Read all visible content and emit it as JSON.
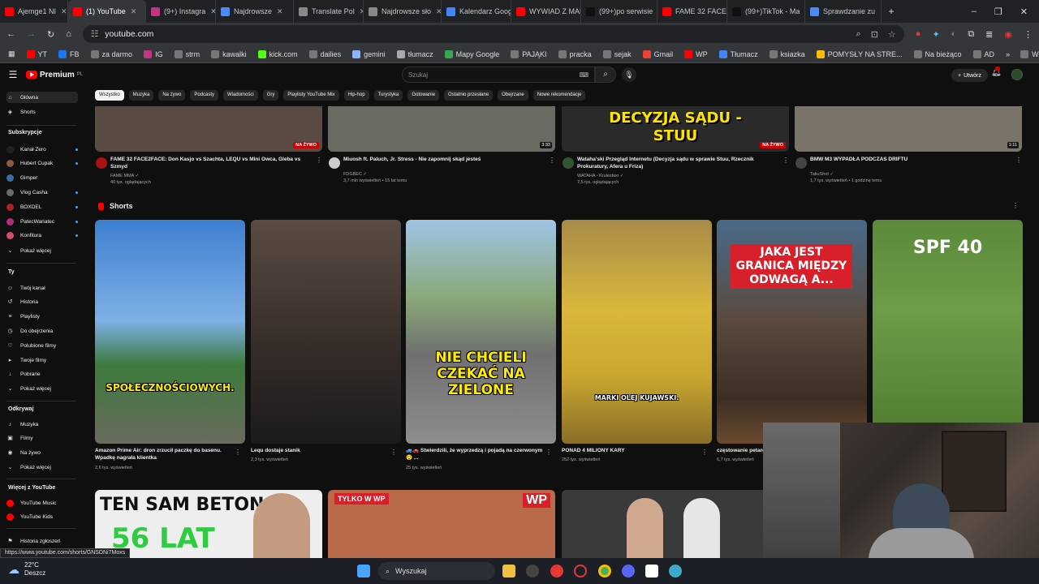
{
  "browser": {
    "tabs": [
      {
        "label": "Ajemge1 NI",
        "color": "#ff0000"
      },
      {
        "label": "(1) YouTube",
        "color": "#ff0000"
      },
      {
        "label": "(9+) Instagra",
        "color": "#c13584"
      },
      {
        "label": "Najdrowsze",
        "color": "#4c8bf5"
      },
      {
        "label": "Translate Pol",
        "color": "#888888"
      },
      {
        "label": "Najdrowsze sło",
        "color": "#888888"
      },
      {
        "label": "Kalendarz Googl",
        "color": "#4285f4"
      },
      {
        "label": "WYWIAD Z MAK",
        "color": "#ff0000"
      },
      {
        "label": "(99+)po serwisie",
        "color": "#111111"
      },
      {
        "label": "FAME 32 FACE2F",
        "color": "#ff0000"
      },
      {
        "label": "(99+)TikTok - Ma",
        "color": "#111111"
      },
      {
        "label": "Sprawdzanie zu",
        "color": "#4c8bf5"
      }
    ],
    "url": "youtube.com",
    "bookmarks": [
      {
        "label": "YT",
        "color": "#ff0000"
      },
      {
        "label": "FB",
        "color": "#1877f2"
      },
      {
        "label": "za darmo",
        "color": "#777777"
      },
      {
        "label": "IG",
        "color": "#c13584"
      },
      {
        "label": "strm",
        "color": "#777777"
      },
      {
        "label": "kawalki",
        "color": "#777777"
      },
      {
        "label": "kick.com",
        "color": "#53fc18"
      },
      {
        "label": "dailies",
        "color": "#777777"
      },
      {
        "label": "gemini",
        "color": "#8ab4f8"
      },
      {
        "label": "tłumacz",
        "color": "#aaaaaa"
      },
      {
        "label": "Mapy Google",
        "color": "#34a853"
      },
      {
        "label": "PAJĄKI",
        "color": "#777777"
      },
      {
        "label": "pracka",
        "color": "#777777"
      },
      {
        "label": "sejak",
        "color": "#777777"
      },
      {
        "label": "Gmail",
        "color": "#ea4335"
      },
      {
        "label": "WP",
        "color": "#ff0000"
      },
      {
        "label": "Tłumacz",
        "color": "#4285f4"
      },
      {
        "label": "ksiazka",
        "color": "#777777"
      },
      {
        "label": "POMYSŁY NA STRE...",
        "color": "#fbbc05"
      },
      {
        "label": "Na bieżąco",
        "color": "#777777"
      },
      {
        "label": "AD",
        "color": "#777777"
      }
    ],
    "all_bookmarks": "Wszystkie zakładki",
    "status_url": "https://www.youtube.com/shorts/GNSDNi7Moxs"
  },
  "youtube": {
    "logo": "Premium",
    "logo_sup": "PL",
    "search_placeholder": "Szukaj",
    "create_label": "Utwórz",
    "chips": [
      "Wszystko",
      "Muzyka",
      "Na żywo",
      "Podcasty",
      "Wiadomości",
      "Gry",
      "Playlisty YouTube Mix",
      "Hip-hop",
      "Turystyka",
      "Gotowanie",
      "Ostatnio przesłane",
      "Obejrzane",
      "Nowe rekomendacje"
    ]
  },
  "sidebar": {
    "main": [
      {
        "label": "Główna",
        "icon": "home-icon",
        "glyph": "⌂"
      },
      {
        "label": "Shorts",
        "icon": "shorts-icon",
        "glyph": "◈"
      }
    ],
    "subs_header": "Subskrypcje",
    "subs": [
      {
        "label": "Kanał Zero",
        "color": "#222222",
        "dot": true
      },
      {
        "label": "Hubert Cupak",
        "color": "#8a5a44",
        "dot": true
      },
      {
        "label": "Gimper",
        "color": "#3a6ea5",
        "dot": false
      },
      {
        "label": "Vlog Casha",
        "color": "#6b6b6b",
        "dot": true
      },
      {
        "label": "BOXDEL",
        "color": "#aa2222",
        "dot": true
      },
      {
        "label": "PatecWariatec",
        "color": "#b03080",
        "dot": true
      },
      {
        "label": "Konfitura",
        "color": "#d0506a",
        "dot": true
      }
    ],
    "subs_more": "Pokaż więcej",
    "you_header": "Ty",
    "you": [
      {
        "label": "Twój kanał",
        "icon": "user-icon",
        "glyph": "☺"
      },
      {
        "label": "Historia",
        "icon": "history-icon",
        "glyph": "↺"
      },
      {
        "label": "Playlisty",
        "icon": "playlist-icon",
        "glyph": "≡"
      },
      {
        "label": "Do obejrzenia",
        "icon": "clock-icon",
        "glyph": "◷"
      },
      {
        "label": "Polubione filmy",
        "icon": "like-icon",
        "glyph": "♡"
      },
      {
        "label": "Twoje filmy",
        "icon": "video-icon",
        "glyph": "▸"
      },
      {
        "label": "Pobrane",
        "icon": "download-icon",
        "glyph": "↓"
      },
      {
        "label": "Pokaż więcej",
        "icon": "chevron-down-icon",
        "glyph": "⌄"
      }
    ],
    "explore_header": "Odkrywaj",
    "explore": [
      {
        "label": "Muzyka",
        "icon": "music-icon",
        "glyph": "♪"
      },
      {
        "label": "Filmy",
        "icon": "film-icon",
        "glyph": "▣"
      },
      {
        "label": "Na żywo",
        "icon": "live-icon",
        "glyph": "◉"
      },
      {
        "label": "Pokaż więcej",
        "icon": "chevron-down-icon",
        "glyph": "⌄"
      }
    ],
    "more_header": "Więcej z YouTube",
    "more": [
      {
        "label": "YouTube Music",
        "color": "#ff0000"
      },
      {
        "label": "YouTube Kids",
        "color": "#ff0000"
      }
    ],
    "report": "Historia zgłoszeń"
  },
  "videos": [
    {
      "title": "FAME 32 FACE2FACE: Don Kasjo vs Szachta, LEQU vs Mini Owca, Gleba vs Szmyd",
      "channel": "FAME MMA",
      "meta": "40 tys. oglądających",
      "badge": "NA ŻYWO",
      "thumb": "#5a4a44",
      "av": "#aa1111"
    },
    {
      "title": "Miuosh ft. Paluch, Jr. Stress - Nie zapomnij skąd jesteś",
      "channel": "FDGBEC",
      "meta": "3,7 mln wyświetleń • 15 lat temu",
      "badge": "3:33",
      "thumb": "#6a6a62",
      "av": "#cccccc"
    },
    {
      "title": "Wataha'ski Przegląd Internetu (Decyzja sądu w sprawie Stuu, Rzecznik Prokuratury, Afera u Friza)",
      "channel": "WATAHA - Krulestwo",
      "meta": "7,5 tys. oglądających",
      "badge": "NA ŻYWO",
      "thumb": "#2a2a2a",
      "av": "#335533"
    },
    {
      "title": "BMW M3 WYPADŁA PODCZAS DRIFTU",
      "channel": "TakuShot",
      "meta": "1,7 tys. wyświetleń • 1 godzinę temu",
      "badge": "1:11",
      "thumb": "#7a7468",
      "av": "#444444"
    }
  ],
  "thumb_text": {
    "decision": "DECYZJA SĄDU - STUU"
  },
  "shorts_header": "Shorts",
  "shorts": [
    {
      "title": "Amazon Prime Air: dron zrzucił paczkę do basenu. Wpadkę nagrała klientka",
      "views": "2,6 tys. wyświetleń",
      "caption": "SPOŁECZNOŚCIOWYCH.",
      "bg": "linear-gradient(180deg,#3d7fd0 0%,#7fb0e6 45%,#3c7a3c 65%,#6b6b5e 100%)"
    },
    {
      "title": "Lequ dostaje stanik",
      "views": "2,3 tys. wyświetleń",
      "caption": "",
      "bg": "linear-gradient(180deg,#5a4c44 0%,#3a302c 50%,#1b1b1b 100%)"
    },
    {
      "title": "🚙🚗 Stwierdzili, że wyprzedzą i pojadą na czerwonym 😲 ...",
      "views": "25 tys. wyświetleń",
      "caption": "NIE CHCIELI CZEKAĆ NA ZIELONE",
      "bg": "linear-gradient(180deg,#9fc4e6 0%,#8aa878 35%,#707070 60%,#8d8d8d 100%)"
    },
    {
      "title": "PONAD 4 MILIONY KARY",
      "views": "252 tys. wyświetleń",
      "caption": "MARKI OLEJ KUJAWSKI.",
      "bg": "linear-gradient(180deg,#a88a48 0%,#d9b83c 40%,#c9a630 70%,#8a6e28 100%)"
    },
    {
      "title": "częstowanie petarda",
      "views": "6,7 tys. wyświetleń",
      "caption": "JAKA JEST GRANICA MIĘDZY ODWAGĄ A...",
      "bg": "linear-gradient(180deg,#4a6a8a 0%,#5a4a3e 45%,#3c2e24 80%,#6a4a2e 100%)"
    },
    {
      "title": "",
      "views": "",
      "caption": "SPF 40",
      "bg": "linear-gradient(180deg,#5a8a3a 0%,#6e9c48 40%,#4e7a30 100%)"
    }
  ],
  "bottom_row": [
    {
      "caption": "TEN SAM BETON",
      "caption2": "56 LAT",
      "bg": "#eeeeee"
    },
    {
      "caption": "TYLKO W WP",
      "caption2": "",
      "bg": "#b86a4a"
    },
    {
      "caption": "",
      "caption2": "",
      "bg": "#3a3a3a"
    }
  ],
  "taskbar": {
    "temp": "22°C",
    "weather": "Deszcz",
    "search": "Wyszukaj"
  }
}
